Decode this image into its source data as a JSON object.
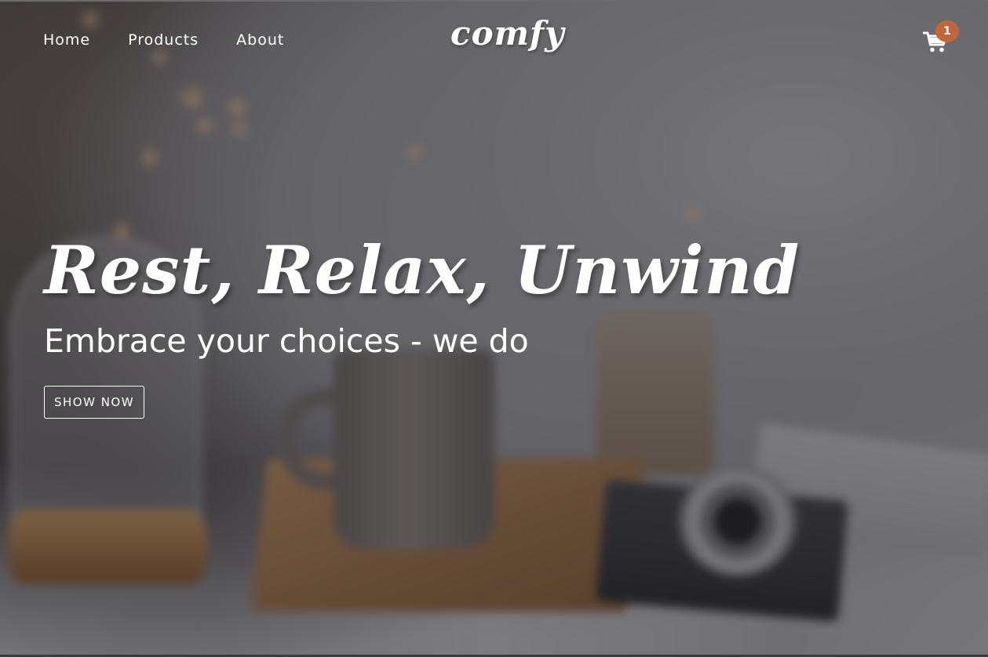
{
  "nav": {
    "links": [
      "Home",
      "Products",
      "About"
    ],
    "logo": "comfy",
    "cart": {
      "count": "1",
      "icon": "cart-icon"
    }
  },
  "banner": {
    "title": "Rest, Relax, Unwind",
    "subtitle": "Embrace your choices - we do",
    "button": "SHOW NOW"
  },
  "colors": {
    "accent": "#c0663a",
    "text": "#ffffff",
    "overlay": "rgba(40,40,46,0.52)"
  }
}
